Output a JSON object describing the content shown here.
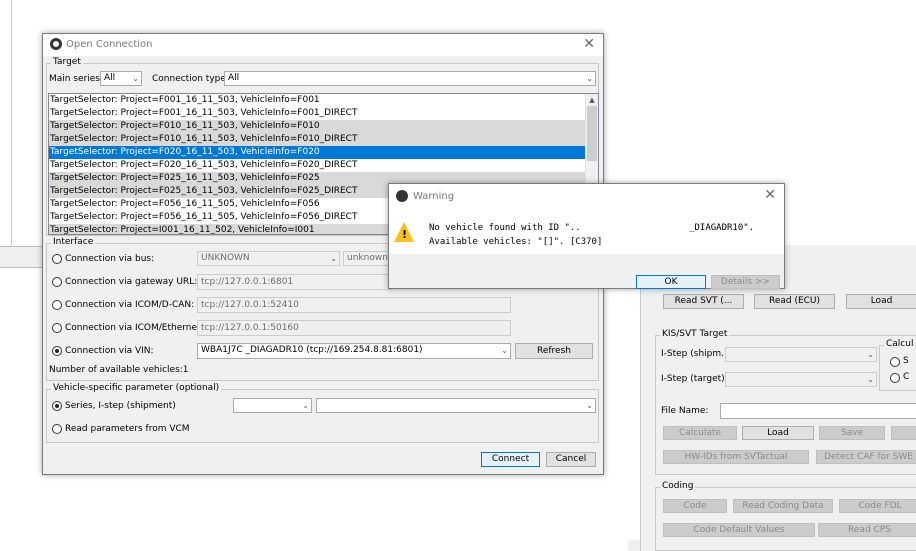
{
  "open_connection": {
    "title": "Open Connection",
    "target_group": "Target",
    "main_series_label": "Main series:",
    "main_series_value": "All",
    "connection_type_label": "Connection type:",
    "connection_type_value": "All",
    "targets": [
      {
        "text": "TargetSelector: Project=F001_16_11_503, VehicleInfo=F001",
        "state": "normal"
      },
      {
        "text": "TargetSelector: Project=F001_16_11_503, VehicleInfo=F001_DIRECT",
        "state": "normal"
      },
      {
        "text": "TargetSelector: Project=F010_16_11_503, VehicleInfo=F010",
        "state": "gray"
      },
      {
        "text": "TargetSelector: Project=F010_16_11_503, VehicleInfo=F010_DIRECT",
        "state": "gray"
      },
      {
        "text": "TargetSelector: Project=F020_16_11_503, VehicleInfo=F020",
        "state": "selected"
      },
      {
        "text": "TargetSelector: Project=F020_16_11_503, VehicleInfo=F020_DIRECT",
        "state": "normal"
      },
      {
        "text": "TargetSelector: Project=F025_16_11_503, VehicleInfo=F025",
        "state": "gray"
      },
      {
        "text": "TargetSelector: Project=F025_16_11_503, VehicleInfo=F025_DIRECT",
        "state": "gray"
      },
      {
        "text": "TargetSelector: Project=F056_16_11_505, VehicleInfo=F056",
        "state": "normal"
      },
      {
        "text": "TargetSelector: Project=F056_16_11_505, VehicleInfo=F056_DIRECT",
        "state": "normal"
      },
      {
        "text": "TargetSelector: Project=I001_16_11_502, VehicleInfo=I001",
        "state": "gray"
      }
    ],
    "interface_group": "Interface",
    "conn_bus_label": "Connection via bus:",
    "conn_bus_value": "UNKNOWN",
    "conn_bus_value2": "unknown",
    "conn_gateway_label": "Connection via gateway URL:",
    "conn_gateway_value": "tcp://127.0.0.1:6801",
    "conn_icom_can_label": "Connection via ICOM/D-CAN:",
    "conn_icom_can_value": "tcp://127.0.0.1:52410",
    "conn_icom_eth_label": "Connection via ICOM/Ethernet:",
    "conn_icom_eth_value": "tcp://127.0.0.1:50160",
    "conn_vin_label": "Connection via VIN:",
    "conn_vin_value": "WBA1J7C                _DIAGADR10 (tcp://169.254.8.81:6801)",
    "refresh_label": "Refresh",
    "available_vehicles": "Number of available vehicles:1",
    "vehicle_param_group": "Vehicle-specific parameter (optional)",
    "series_istep_label": "Series, I-step (shipment)",
    "read_vcm_label": "Read parameters from VCM",
    "connect_label": "Connect",
    "cancel_label": "Cancel"
  },
  "warning": {
    "title": "Warning",
    "line1": "No vehicle found with ID \"..                    _DIAGADR10\".",
    "line2": "Available vehicles: \"[]\". [C370]",
    "ok_label": "OK",
    "details_label": "Details >>"
  },
  "bg_panel": {
    "read_svt_label": "Read SVT (...",
    "read_ecu_label": "Read (ECU)",
    "load_label": "Load",
    "kis_svt_group": "KIS/SVT Target",
    "istep_shipm_label": "I-Step (shipm.):",
    "istep_target_label": "I-Step (target):",
    "calc_group": "Calcul",
    "radio1_text": "S",
    "radio2_text": "C",
    "file_name_label": "File Name:",
    "calculate_label": "Calculate",
    "load2_label": "Load",
    "save_label": "Save",
    "hw_ids_label": "HW-IDs from SVTactual",
    "detect_caf_label": "Detect CAF for SWE",
    "coding_group": "Coding",
    "code_label": "Code",
    "read_coding_label": "Read Coding Data",
    "code_fdl_label": "Code FDL",
    "code_default_label": "Code Default Values",
    "read_cps_label": "Read CPS"
  }
}
